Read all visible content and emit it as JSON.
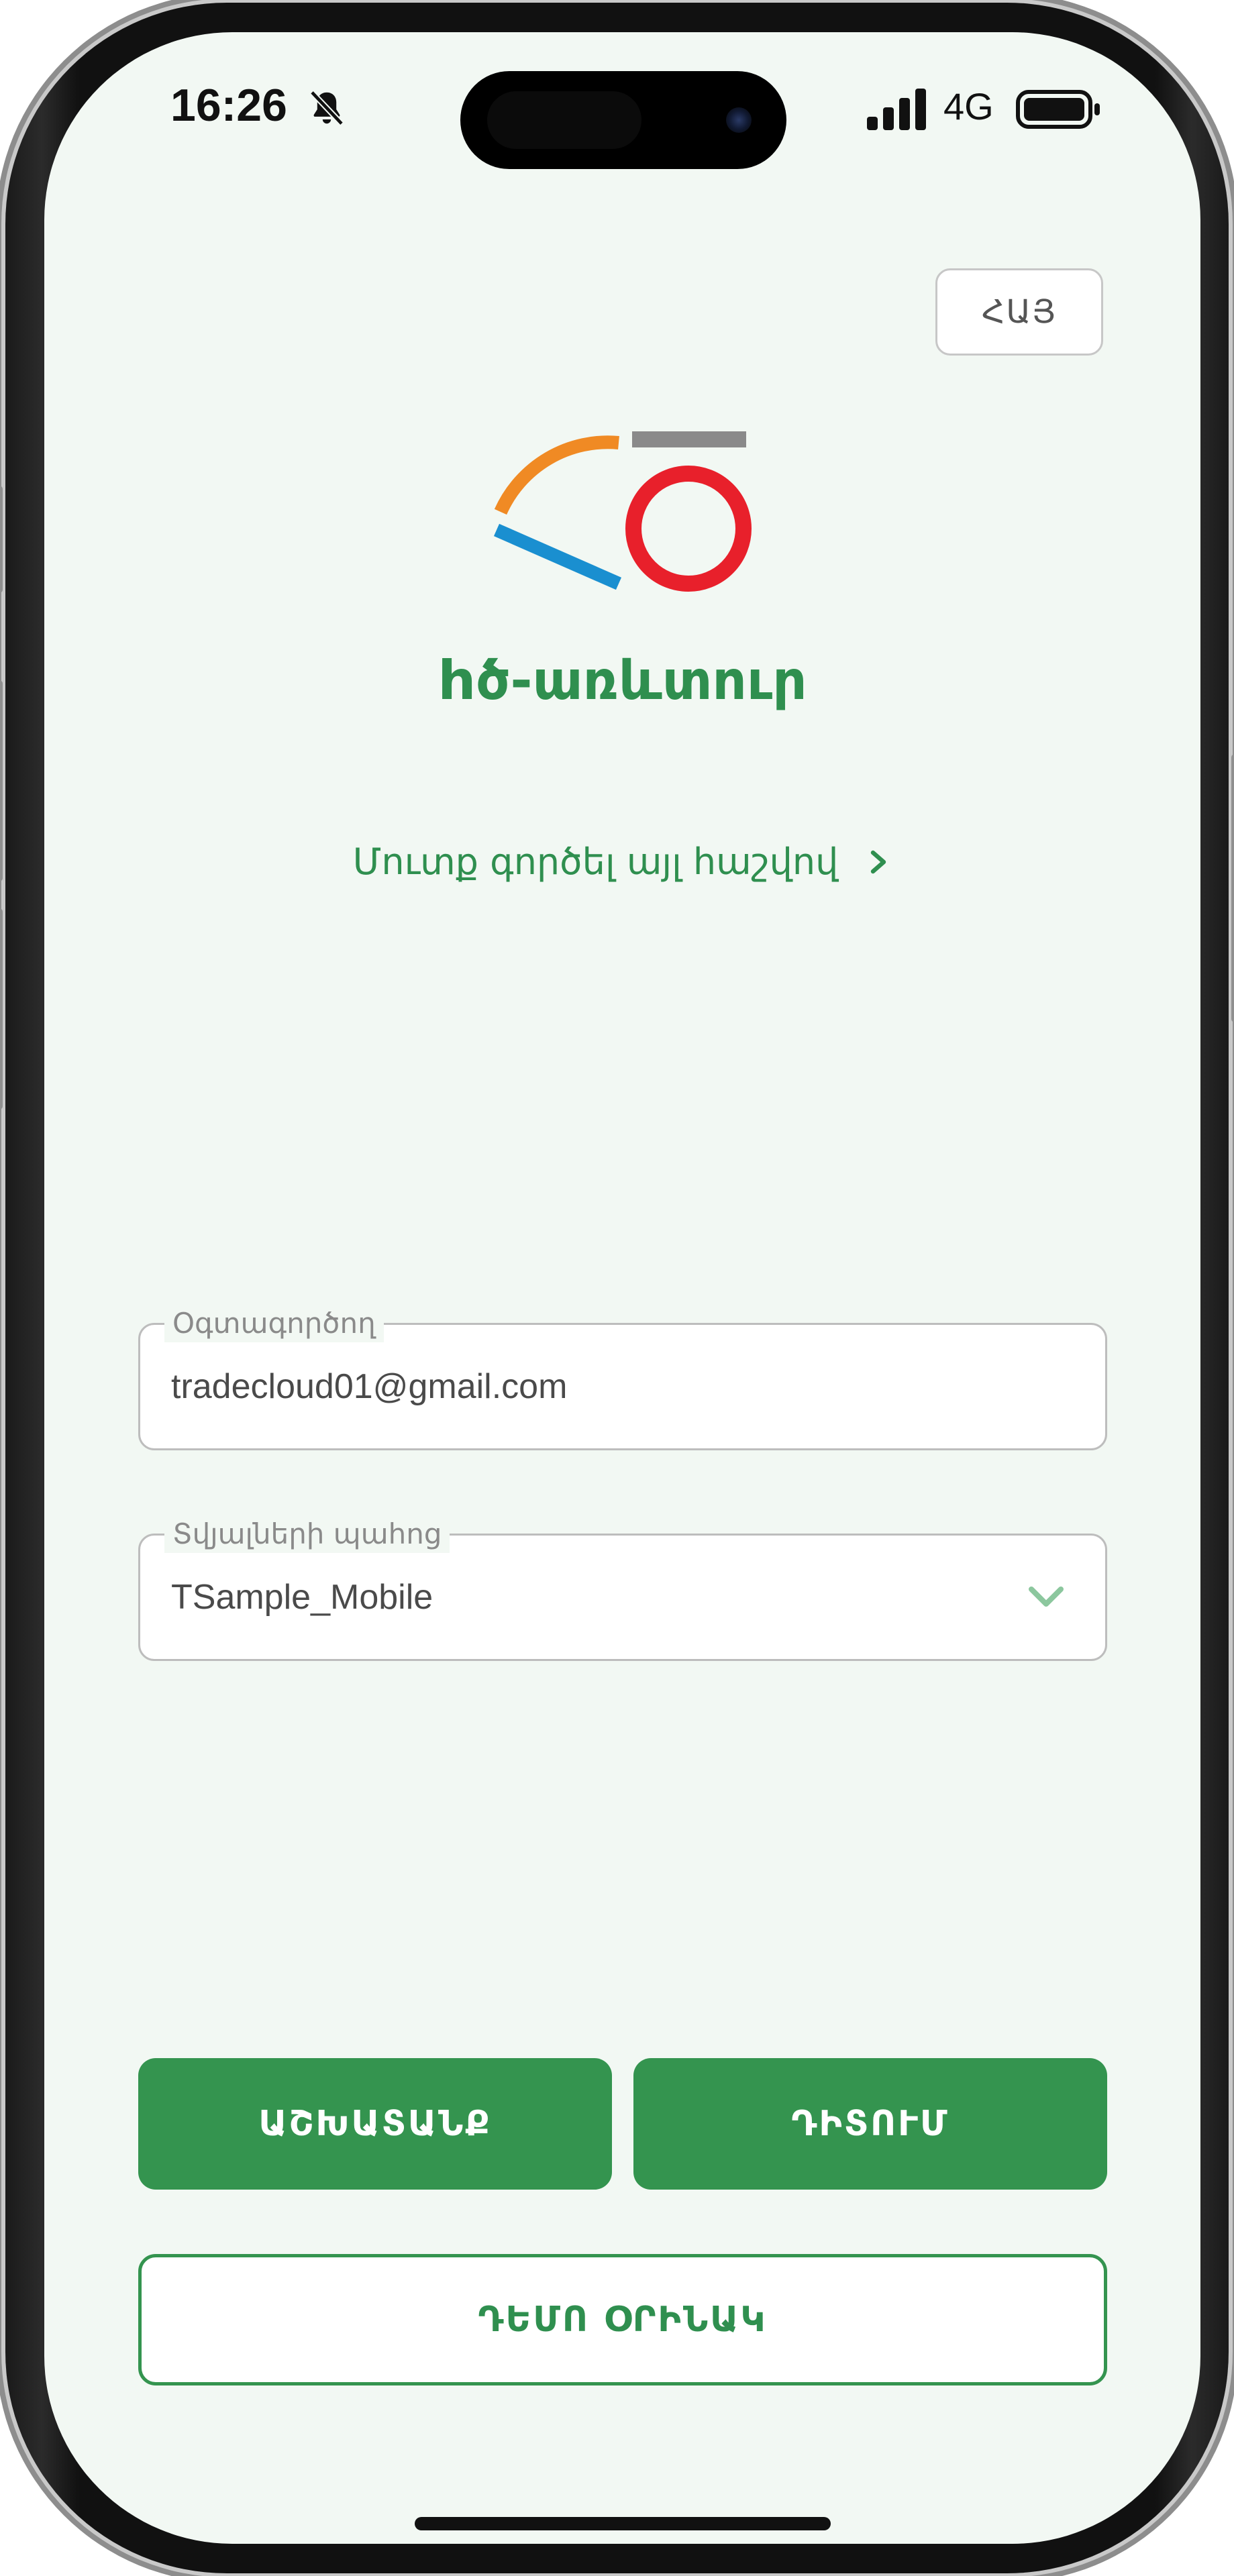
{
  "status_bar": {
    "time": "16:26",
    "network": "4G"
  },
  "language_button": {
    "label": "ՀԱՅ"
  },
  "app": {
    "title": "hծ-առևտուր"
  },
  "other_account_link": {
    "label": "Մուտք գործել այլ հաշվով"
  },
  "username_field": {
    "label": "Օգտագործող",
    "value": "tradecloud01@gmail.com"
  },
  "database_field": {
    "label": "Տվյալների պահոց",
    "value": "TSample_Mobile"
  },
  "buttons": {
    "work": "ԱՇԽԱՏԱՆՔ",
    "view": "ԴԻՏՈՒՄ",
    "demo": "ԴԵՄՈ ՕՐԻՆԱԿ"
  },
  "colors": {
    "brand_green": "#34944f",
    "background": "#f2f8f3",
    "logo_orange": "#f08a24",
    "logo_blue": "#1a8fd0",
    "logo_red": "#e8202b",
    "logo_gray": "#8a8a8a"
  }
}
